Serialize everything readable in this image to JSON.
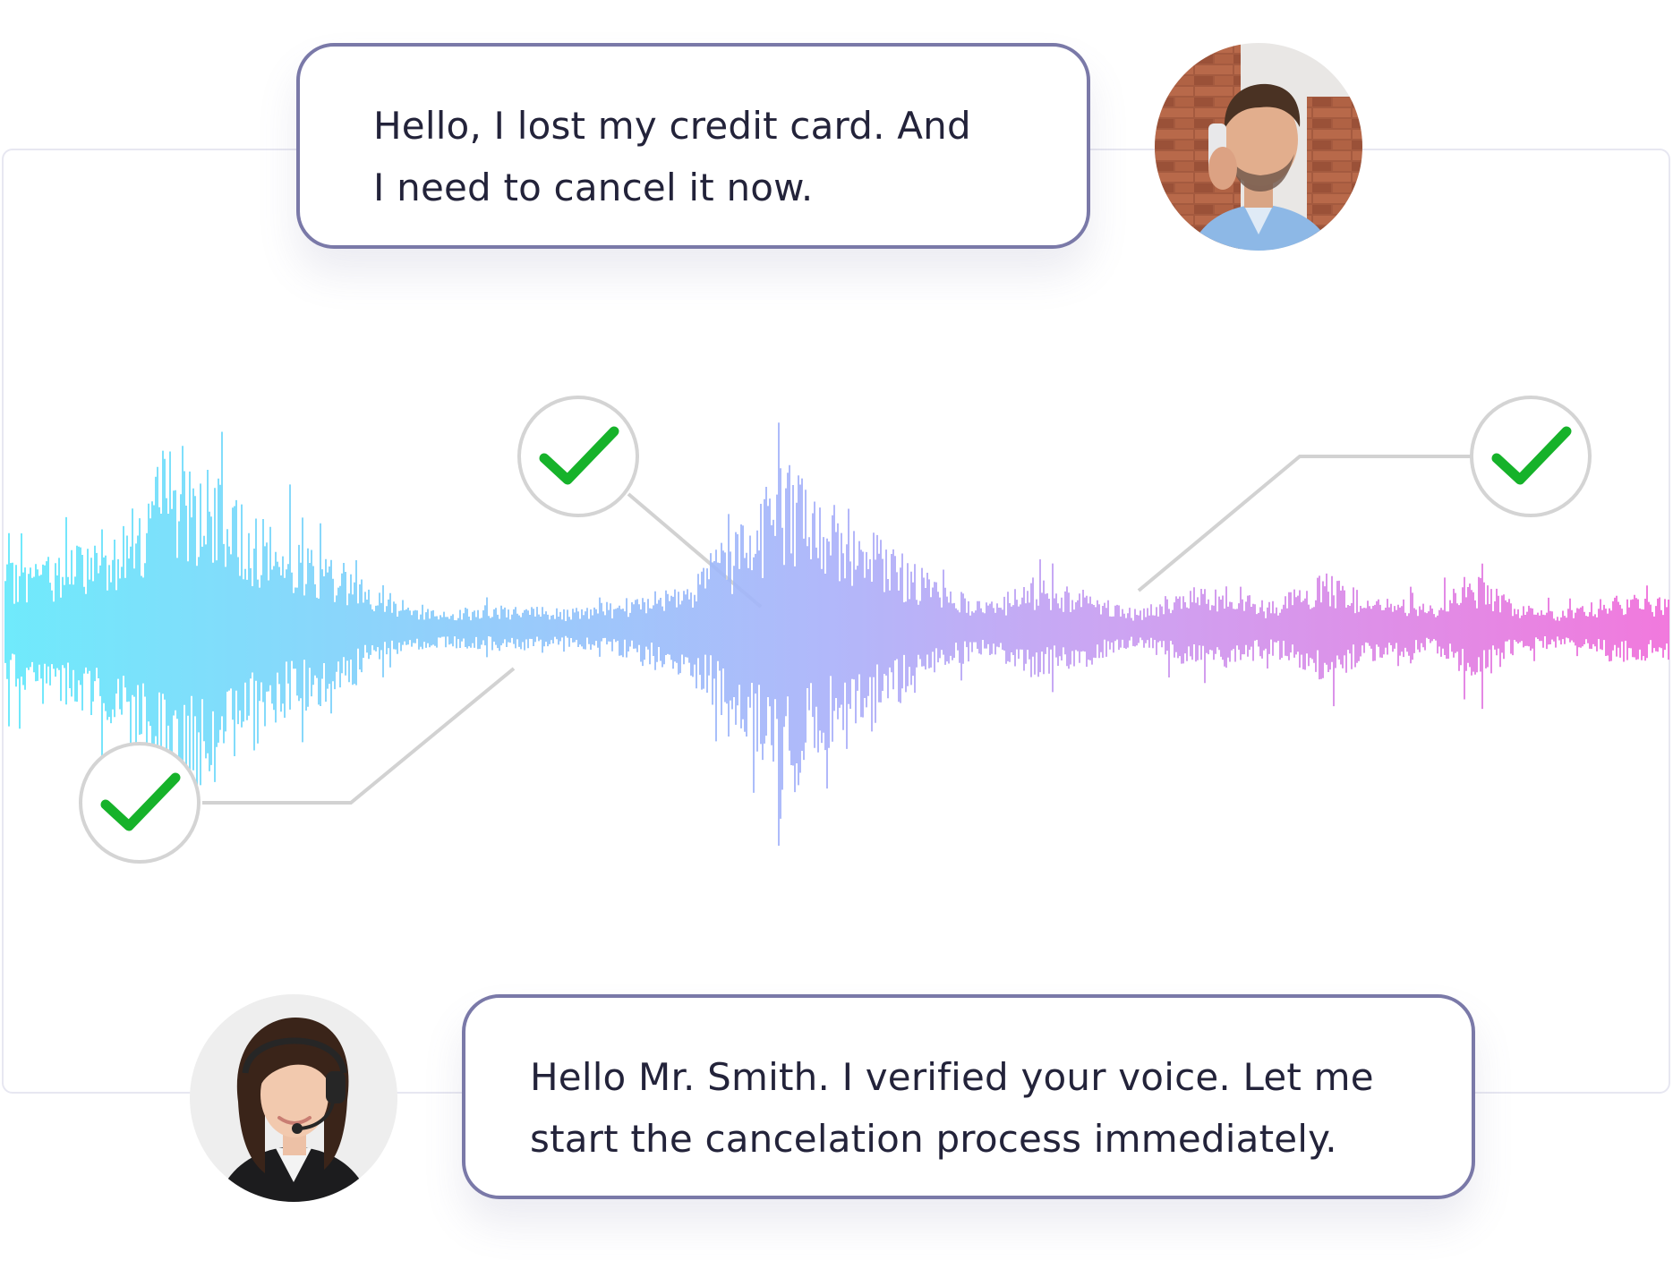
{
  "conversation": {
    "customer_message": {
      "line1": "Hello, I lost my credit card. And",
      "line2": "I need to cancel it now."
    },
    "agent_message": {
      "line1": "Hello Mr. Smith. I verified your voice. Let me",
      "line2": "start the cancelation process immediately."
    }
  },
  "verification_marks": [
    {
      "icon": "checkmark-icon",
      "status": "verified"
    },
    {
      "icon": "checkmark-icon",
      "status": "verified"
    },
    {
      "icon": "checkmark-icon",
      "status": "verified"
    }
  ],
  "avatars": {
    "customer": {
      "icon": "customer-on-phone-photo"
    },
    "agent": {
      "icon": "support-agent-headset-photo"
    }
  },
  "colors": {
    "bubble_border": "#7a79a8",
    "text": "#23233a",
    "check_green": "#16b22a",
    "check_ring": "#d4d4d4",
    "connector": "#d2d2d2",
    "frame_border": "#e7e7f1",
    "wave_start": "#5fe8fb",
    "wave_mid": "#a6b2fa",
    "wave_late": "#c69bf1",
    "wave_end": "#f06ad9"
  }
}
